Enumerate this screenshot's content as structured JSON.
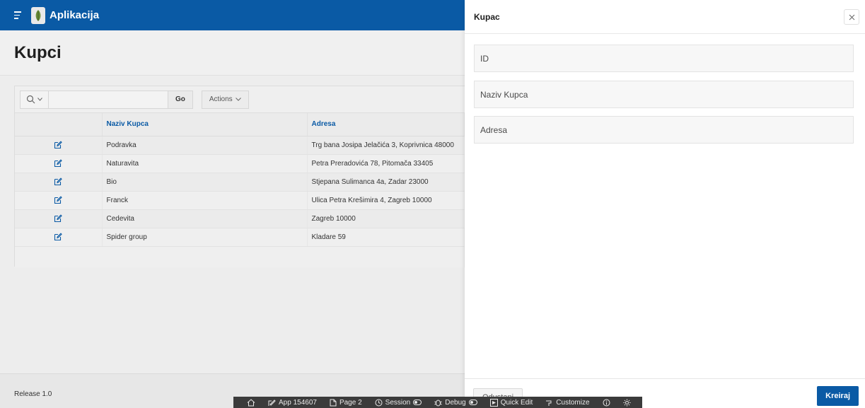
{
  "header": {
    "app_title": "Aplikacija"
  },
  "page": {
    "title": "Kupci",
    "toolbar": {
      "go_label": "Go",
      "actions_label": "Actions"
    },
    "table": {
      "columns": [
        "",
        "Naziv Kupca",
        "Adresa"
      ],
      "rows": [
        {
          "naziv": "Podravka",
          "adresa": "Trg bana Josipa Jelačića 3, Koprivnica 48000"
        },
        {
          "naziv": "Naturavita",
          "adresa": "Petra Preradovića 78, Pitomača 33405"
        },
        {
          "naziv": "Bio",
          "adresa": "Stjepana Sulimanca 4a, Zadar 23000"
        },
        {
          "naziv": "Franck",
          "adresa": "Ulica Petra Krešimira 4, Zagreb 10000"
        },
        {
          "naziv": "Cedevita",
          "adresa": "Zagreb 10000"
        },
        {
          "naziv": "Spider group",
          "adresa": "Kladare 59"
        }
      ]
    },
    "footer": {
      "release": "Release 1.0"
    }
  },
  "dialog": {
    "title": "Kupac",
    "fields": {
      "id_label": "ID",
      "naziv_label": "Naziv Kupca",
      "adresa_label": "Adresa"
    },
    "cancel_label": "Odustani",
    "create_label": "Kreiraj"
  },
  "devbar": {
    "app": "App 154607",
    "page": "Page 2",
    "session": "Session",
    "debug": "Debug",
    "quick_edit": "Quick Edit",
    "customize": "Customize"
  },
  "colors": {
    "brand": "#0a5aa5",
    "devbar": "#3b3b3b"
  }
}
